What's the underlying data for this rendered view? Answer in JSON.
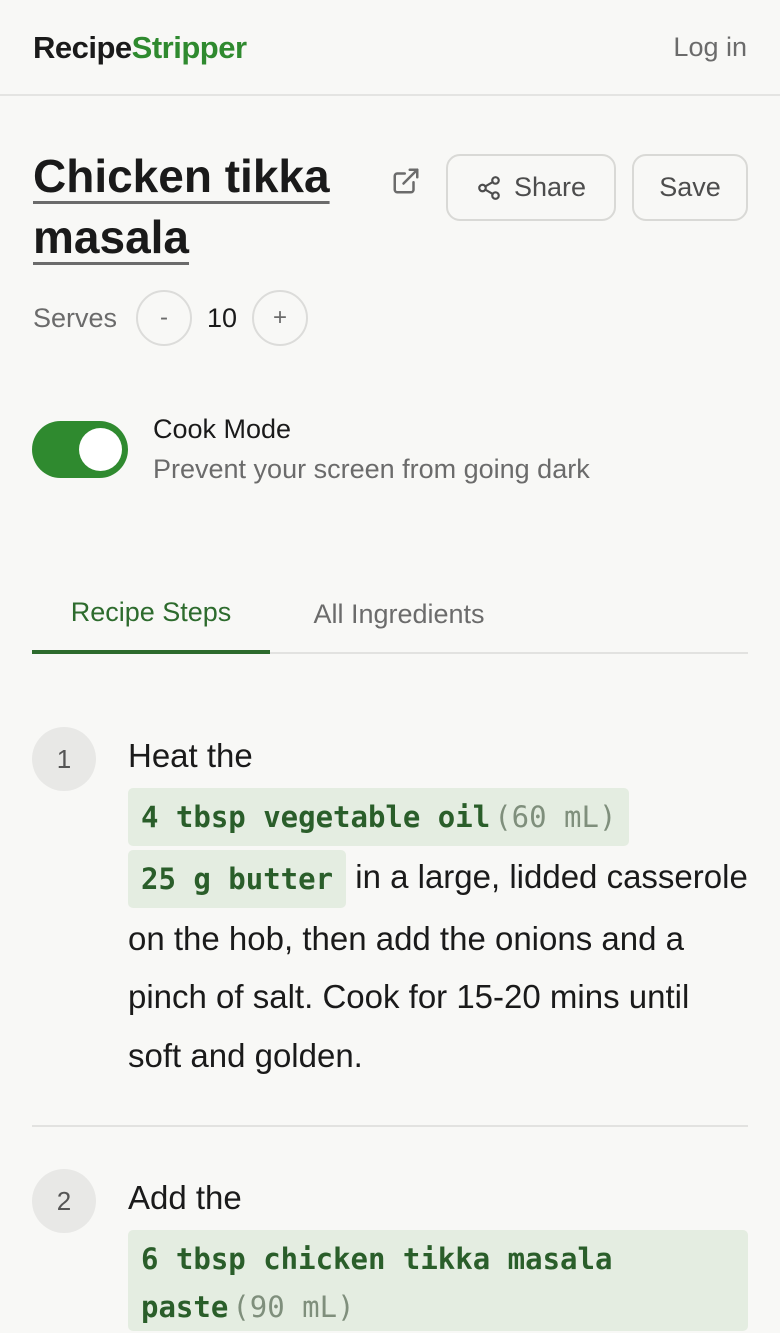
{
  "header": {
    "brand_part1": "Recipe",
    "brand_part2": "Stripper",
    "login_label": "Log in"
  },
  "recipe": {
    "title": "Chicken tikka masala",
    "share_label": "Share",
    "save_label": "Save",
    "serves_label": "Serves",
    "serves_count": "10",
    "minus_label": "-",
    "plus_label": "+"
  },
  "cook_mode": {
    "title": "Cook Mode",
    "subtitle": "Prevent your screen from going dark",
    "enabled": true
  },
  "tabs": [
    {
      "label": "Recipe Steps",
      "active": true
    },
    {
      "label": "All Ingredients",
      "active": false
    }
  ],
  "steps": [
    {
      "number": "1",
      "intro": "Heat the",
      "ingredients": [
        {
          "text": "4 tbsp vegetable oil",
          "metric": "(60 mL)"
        },
        {
          "text": "25 g butter",
          "metric": ""
        }
      ],
      "rest": "in a large, lidded casserole on the hob, then add the onions and a pinch of salt. Cook for 15-20 mins until soft and golden."
    },
    {
      "number": "2",
      "intro": "Add the",
      "ingredients": [
        {
          "text": "6 tbsp chicken tikka masala paste",
          "metric": "(90 mL)"
        }
      ]
    }
  ],
  "colors": {
    "accent": "#2f8a2f",
    "tab_active": "#2d6b2d",
    "ingredient_bg": "#e4ede1",
    "background": "#f8f8f6"
  }
}
